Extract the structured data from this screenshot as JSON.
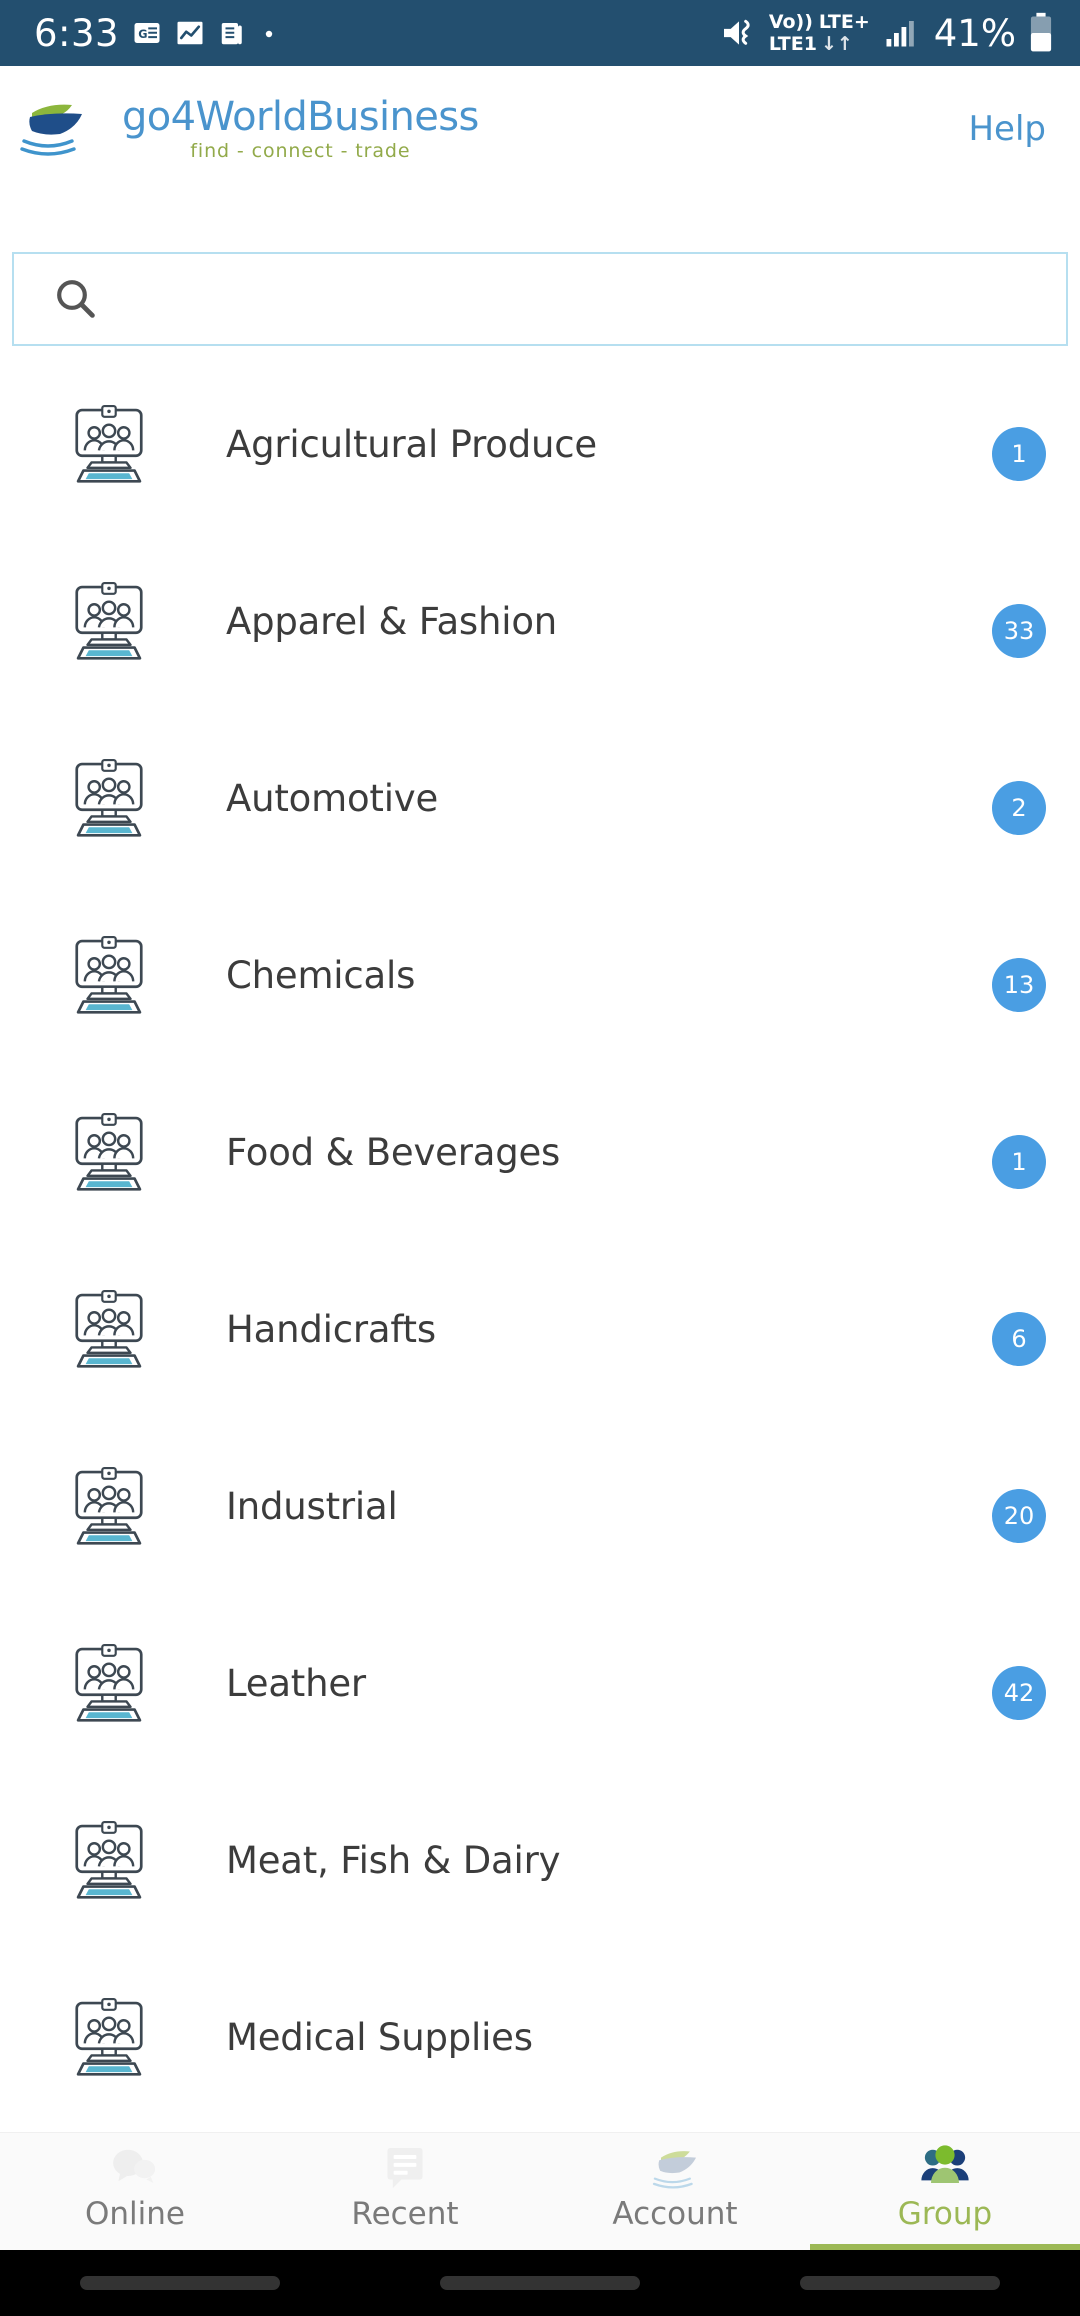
{
  "status_bar": {
    "time": "6:33",
    "notification_icons": [
      "google-news-icon",
      "stocks-chart-icon",
      "document-icon",
      "dot-icon"
    ],
    "mute_icon": "volume-mute-icon",
    "volte_label": "Vo))",
    "sim_label": "LTE1",
    "network_label": "LTE+",
    "data_arrows": "↓↑",
    "signal_icon": "signal-bars-icon",
    "battery_percent": "41%",
    "background_color": "#234f6f",
    "foreground_color": "#ffffff"
  },
  "header": {
    "logo_icon": "ship-logo-icon",
    "brand_name": "go4WorldBusiness",
    "brand_tagline": "find - connect - trade",
    "help_label": "Help",
    "brand_color": "#4a94cd",
    "tagline_color": "#92aa4a"
  },
  "search": {
    "icon": "search-icon",
    "value": "",
    "placeholder": "",
    "border_color": "#b6dff0"
  },
  "categories": {
    "badge_color": "#4a9ee3",
    "items": [
      {
        "label": "Agricultural Produce",
        "badge": "1",
        "icon": "group-monitor-icon"
      },
      {
        "label": "Apparel & Fashion",
        "badge": "33",
        "icon": "group-monitor-icon"
      },
      {
        "label": "Automotive",
        "badge": "2",
        "icon": "group-monitor-icon"
      },
      {
        "label": "Chemicals",
        "badge": "13",
        "icon": "group-monitor-icon"
      },
      {
        "label": "Food & Beverages",
        "badge": "1",
        "icon": "group-monitor-icon"
      },
      {
        "label": "Handicrafts",
        "badge": "6",
        "icon": "group-monitor-icon"
      },
      {
        "label": "Industrial",
        "badge": "20",
        "icon": "group-monitor-icon"
      },
      {
        "label": "Leather",
        "badge": "42",
        "icon": "group-monitor-icon"
      },
      {
        "label": "Meat, Fish & Dairy",
        "badge": "",
        "icon": "group-monitor-icon"
      },
      {
        "label": "Medical Supplies",
        "badge": "",
        "icon": "group-monitor-icon"
      }
    ]
  },
  "bottom_nav": {
    "active_color": "#9cb855",
    "inactive_color": "#7a7a7a",
    "tabs": [
      {
        "label": "Online",
        "icon": "chat-bubbles-icon",
        "active": false
      },
      {
        "label": "Recent",
        "icon": "message-lines-icon",
        "active": false
      },
      {
        "label": "Account",
        "icon": "ship-icon",
        "active": false
      },
      {
        "label": "Group",
        "icon": "people-group-icon",
        "active": true
      }
    ]
  },
  "android_nav": {
    "buttons": [
      "recents-pill",
      "home-pill",
      "back-pill"
    ]
  }
}
